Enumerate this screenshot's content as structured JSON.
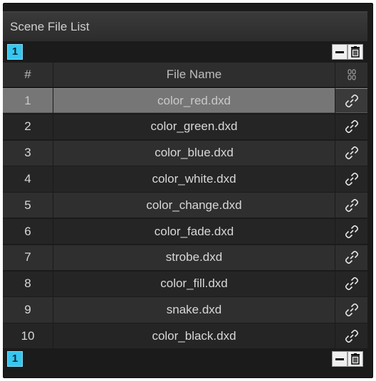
{
  "panel": {
    "title": "Scene File List"
  },
  "pager": {
    "top_page": "1",
    "bottom_page": "1"
  },
  "table": {
    "columns": {
      "number": "#",
      "file_name": "File Name",
      "link_icon": "chain-icon"
    },
    "selected_row": 1,
    "rows": [
      {
        "number": "1",
        "file_name": "color_red.dxd"
      },
      {
        "number": "2",
        "file_name": "color_green.dxd"
      },
      {
        "number": "3",
        "file_name": "color_blue.dxd"
      },
      {
        "number": "4",
        "file_name": "color_white.dxd"
      },
      {
        "number": "5",
        "file_name": "color_change.dxd"
      },
      {
        "number": "6",
        "file_name": "color_fade.dxd"
      },
      {
        "number": "7",
        "file_name": "strobe.dxd"
      },
      {
        "number": "8",
        "file_name": "color_fill.dxd"
      },
      {
        "number": "9",
        "file_name": "snake.dxd"
      },
      {
        "number": "10",
        "file_name": "color_black.dxd"
      }
    ]
  },
  "colors": {
    "accent": "#37c6ef",
    "panel_bg": "#1b1b1b",
    "selected_row": "#767676"
  }
}
